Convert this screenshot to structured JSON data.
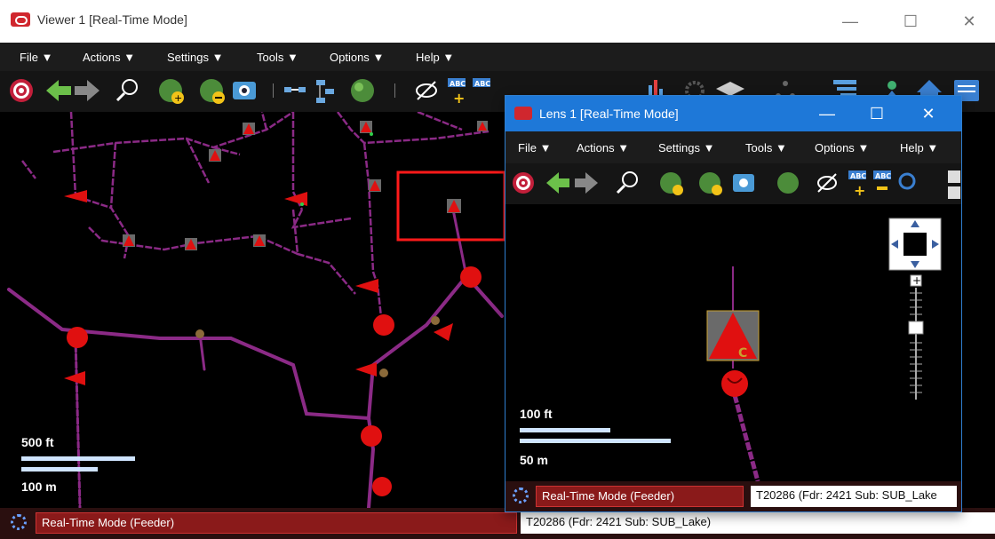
{
  "viewer": {
    "title": "Viewer 1 [Real-Time Mode]",
    "window_controls": {
      "minimize": "—",
      "maximize": "☐",
      "close": "✕"
    },
    "menu": [
      {
        "label": "File"
      },
      {
        "label": "Actions"
      },
      {
        "label": "Settings"
      },
      {
        "label": "Tools"
      },
      {
        "label": "Options"
      },
      {
        "label": "Help"
      }
    ],
    "menu_arrow": "▼",
    "scale": {
      "top_label": "500 ft",
      "bottom_label": "100 m"
    },
    "status": {
      "mode": "Real-Time Mode (Feeder)",
      "info": "T20286 (Fdr: 2421 Sub: SUB_Lake)"
    }
  },
  "lens": {
    "title": "Lens 1 [Real-Time Mode]",
    "window_controls": {
      "minimize": "—",
      "maximize": "☐",
      "close": "✕"
    },
    "menu": [
      {
        "label": "File"
      },
      {
        "label": "Actions"
      },
      {
        "label": "Settings"
      },
      {
        "label": "Tools"
      },
      {
        "label": "Options"
      },
      {
        "label": "Help"
      }
    ],
    "scale": {
      "top_label": "100 ft",
      "bottom_label": "50 m"
    },
    "status": {
      "mode": "Real-Time Mode (Feeder)",
      "info": "T20286 (Fdr: 2421 Sub: SUB_Lake"
    },
    "transformer_letter": "C"
  },
  "colors": {
    "feeder_line": "#8b2a86",
    "device_red": "#e01010",
    "device_gray": "#6a6a6a",
    "selection": "#ff1a1a",
    "map_bg": "#000000",
    "status_mode_bg": "#8a1a1a"
  },
  "toolbar_icons": [
    "target-icon",
    "back-arrow-icon",
    "forward-arrow-icon",
    "zoom-icon",
    "globe-add-icon",
    "globe-remove-icon",
    "camera-icon",
    "connect-icon",
    "network-icon",
    "globe-icon",
    "hide-icon",
    "label-add-icon",
    "label-remove-icon",
    "find-icon",
    "find2-icon",
    "abc-icon",
    "bar-icon",
    "gear-icon",
    "hat-icon",
    "tree-icon",
    "layers-icon",
    "person-icon",
    "home-icon",
    "panel-icon"
  ]
}
